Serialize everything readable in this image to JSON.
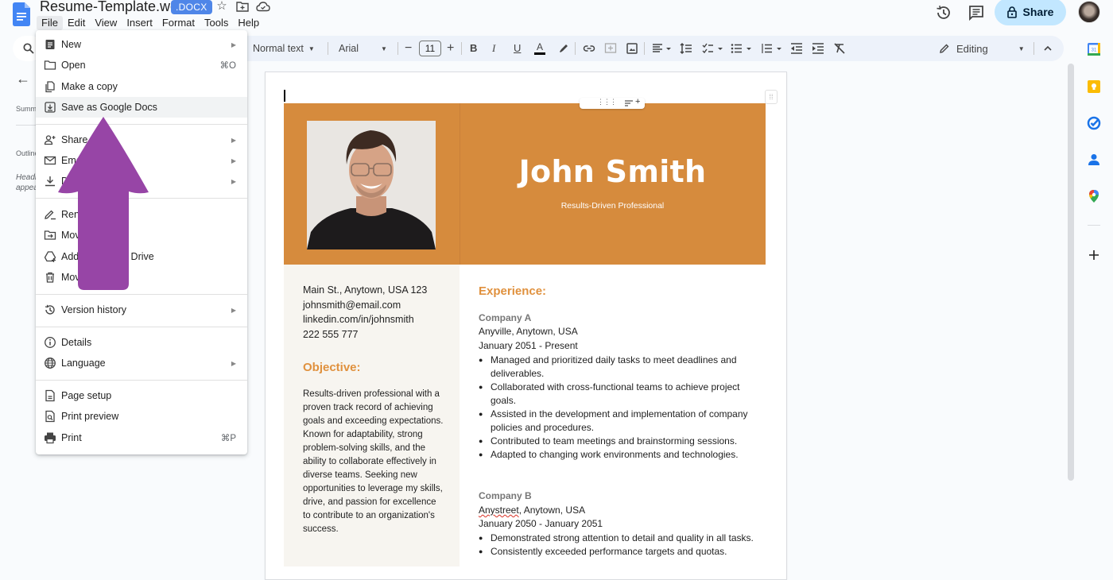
{
  "app": {
    "doc_title": "Resume-Template.word",
    "file_badge": ".DOCX",
    "menus": [
      "File",
      "Edit",
      "View",
      "Insert",
      "Format",
      "Tools",
      "Help"
    ],
    "active_menu": "File",
    "share_label": "Share",
    "icons": {
      "title": [
        "star-icon",
        "move-to-folder-icon",
        "cloud-saved-icon"
      ],
      "top_right": [
        "version-history-icon",
        "comments-icon",
        "lock-icon",
        "user-avatar"
      ]
    }
  },
  "toolbar": {
    "style": "Normal text",
    "font": "Arial",
    "font_size": "11",
    "minus": "−",
    "plus": "+",
    "mode": "Editing",
    "icons": [
      "bold-icon",
      "italic-icon",
      "underline-icon",
      "text-color-icon",
      "highlight-icon",
      "link-icon",
      "add-comment-icon",
      "insert-image-icon",
      "align-icon",
      "line-spacing-icon",
      "checklist-icon",
      "bulleted-list-icon",
      "numbered-list-icon",
      "decrease-indent-icon",
      "increase-indent-icon",
      "clear-formatting-icon"
    ]
  },
  "outline_panel": {
    "summary_label": "Summary",
    "outline_label": "Outline",
    "hint_line1": "Headings you add to the document will",
    "hint_line2": "appear here."
  },
  "file_menu": {
    "items": [
      {
        "label": "New",
        "icon": "new-document-icon",
        "submenu": true
      },
      {
        "label": "Open",
        "icon": "folder-icon",
        "shortcut": "⌘O"
      },
      {
        "label": "Make a copy",
        "icon": "copy-icon"
      },
      {
        "label": "Save as Google Docs",
        "icon": "save-download-icon",
        "highlighted": true
      },
      {
        "label": "Share",
        "icon": "share-person-icon",
        "submenu": true
      },
      {
        "label": "Email",
        "icon": "email-icon",
        "submenu": true
      },
      {
        "label": "Download",
        "icon": "download-icon",
        "submenu": true
      },
      {
        "label": "Rename",
        "icon": "rename-icon"
      },
      {
        "label": "Move",
        "icon": "move-folder-icon"
      },
      {
        "label": "Add shortcut to Drive",
        "icon": "drive-shortcut-icon"
      },
      {
        "label": "Move to trash",
        "icon": "trash-icon"
      },
      {
        "label": "Version history",
        "icon": "history-icon",
        "submenu": true
      },
      {
        "label": "Details",
        "icon": "info-icon"
      },
      {
        "label": "Language",
        "icon": "globe-icon",
        "submenu": true
      },
      {
        "label": "Page setup",
        "icon": "page-setup-icon"
      },
      {
        "label": "Print preview",
        "icon": "print-preview-icon"
      },
      {
        "label": "Print",
        "icon": "printer-icon",
        "shortcut": "⌘P"
      }
    ]
  },
  "annotation": {
    "color": "#9745a6",
    "type": "up-arrow"
  },
  "resume": {
    "name": "John Smith",
    "tagline": "Results-Driven Professional",
    "accent_color": "#d68b3d",
    "contact": [
      "Main St., Anytown, USA 123",
      "johnsmith@email.com",
      "linkedin.com/in/johnsmith",
      "222 555 777"
    ],
    "objective_heading": "Objective:",
    "objective": "Results-driven professional with a proven track record of achieving goals and exceeding expectations. Known for adaptability, strong problem-solving skills, and the ability to collaborate effectively in diverse teams. Seeking new opportunities to leverage my skills, drive, and passion for excellence to contribute to an organization's success.",
    "experience_heading": "Experience:",
    "jobs": [
      {
        "company": "Company A",
        "location": "Anyville, Anytown, USA",
        "dates": "January 2051 - Present",
        "bullets": [
          "Managed and prioritized daily tasks to meet deadlines and deliverables.",
          "Collaborated with cross-functional teams to achieve project goals.",
          "Assisted in the development and implementation of company policies and procedures.",
          "Contributed to team meetings and brainstorming sessions.",
          "Adapted to changing work environments and technologies."
        ]
      },
      {
        "company": "Company B",
        "location_misspelled": "Anystreet",
        "location_rest": ", Anytown, USA",
        "dates": "January 2050 - January 2051",
        "bullets": [
          "Demonstrated strong attention to detail and quality in all tasks.",
          "Consistently exceeded performance targets and quotas."
        ]
      }
    ]
  },
  "right_sidebar": [
    "calendar-icon",
    "keep-icon",
    "tasks-icon",
    "contacts-icon",
    "maps-icon",
    "add-addon-icon"
  ]
}
